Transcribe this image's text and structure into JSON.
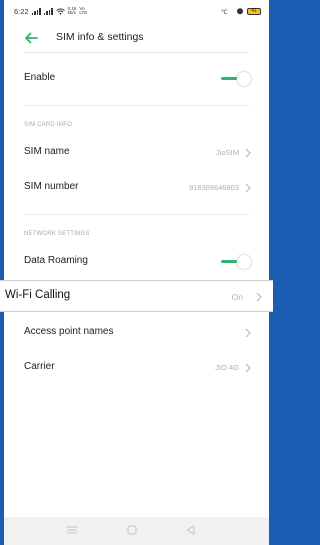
{
  "status_bar": {
    "time": "6:22",
    "network_speed_top": "0.15",
    "network_speed_bottom": "kb/s",
    "volte_label": "Vo LTE",
    "battery_level": "41"
  },
  "header": {
    "title": "SIM info & settings"
  },
  "rows": {
    "enable": {
      "label": "Enable",
      "toggle_on": true
    },
    "sim_name": {
      "label": "SIM name",
      "value": "JioSIM"
    },
    "sim_number": {
      "label": "SIM number",
      "value": "918369646803"
    },
    "data_roaming": {
      "label": "Data Roaming",
      "toggle_on": true
    },
    "wifi_calling": {
      "label": "Wi-Fi Calling",
      "value": "On"
    },
    "access_point_names": {
      "label": "Access point names"
    },
    "carrier": {
      "label": "Carrier",
      "value": "JIO 4G"
    }
  },
  "sections": {
    "sim_card_info": "SIM CARD INFO",
    "network_settings": "NETWORK SETTINGS"
  },
  "colors": {
    "accent": "#2bb673",
    "frame": "#1c5db3"
  },
  "icons": {
    "back": "arrow-left-icon",
    "chevron": "chevron-right-icon",
    "nav_menu": "menu-icon",
    "nav_home": "home-icon",
    "nav_back": "back-triangle-icon"
  }
}
